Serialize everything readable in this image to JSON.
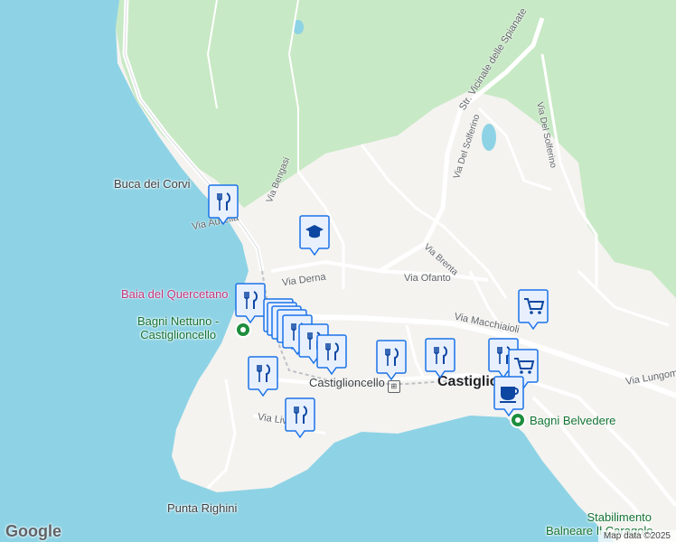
{
  "colors": {
    "sea": "#8ed3e5",
    "land": "#f4f3f0",
    "park": "#c8e9c5",
    "road": "#ffffff",
    "pin_fill": "#e8f0fe",
    "pin_stroke": "#1a73e8",
    "icon": "#0d47a1",
    "beach_marker": "#1e8e3e"
  },
  "labels": {
    "buca_dei_corvi": "Buca dei Corvi",
    "via_aurelia": "Via Aurelia",
    "via_bengasi": "Via Bengasi",
    "via_derna": "Via Derna",
    "baia_del_quercetano": "Baia del Quercetano",
    "bagni_nettuno": "Bagni Nettuno -",
    "bagni_nettuno_2": "Castiglioncello",
    "str_vicinale": "Str. Vicinale delle Spianate",
    "via_del_solferino_1": "Via Del Solferino",
    "via_del_solferino_2": "Via Del Solferino",
    "via_brenta": "Via Brenta",
    "via_ofanto": "Via Ofanto",
    "via_macchiaioli": "Via Macchiaioli",
    "via_lungomare": "Via Lungom",
    "castiglioncello_station": "Castiglioncello",
    "castiglioncello_town": "Castiglio",
    "via_livornese": "Via Liv",
    "bagni_belvedere": "Bagni Belvedere",
    "punta_righini": "Punta Righini",
    "stabilimento_1": "Stabilimento",
    "stabilimento_2": "Balneare Il Caragolo"
  },
  "pins": {
    "restaurant_icon": "restaurant-icon",
    "school_icon": "school-icon",
    "shopping_icon": "shopping-cart-icon",
    "cafe_icon": "cafe-icon",
    "bag_icon": "shopping-bag-icon"
  },
  "footer": {
    "google": "Google",
    "attribution": "Map data ©2025"
  }
}
